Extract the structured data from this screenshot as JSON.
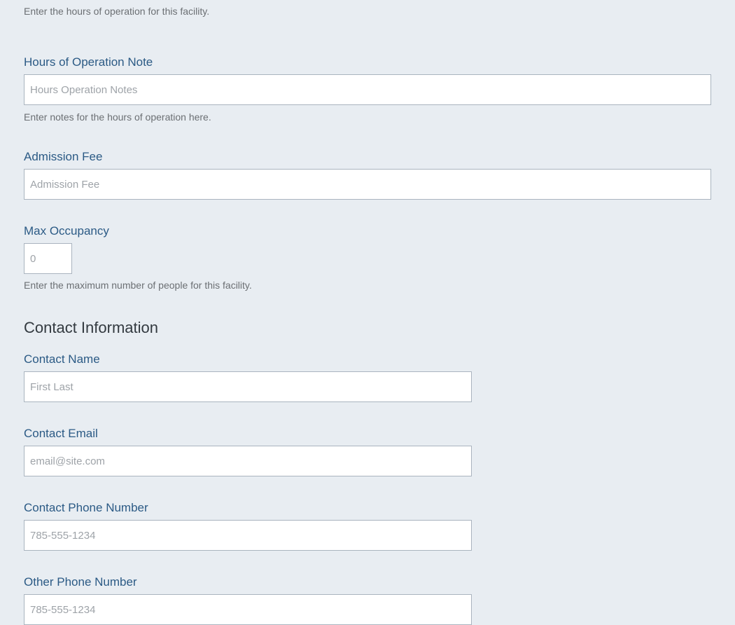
{
  "hours": {
    "help": "Enter the hours of operation for this facility."
  },
  "hours_note": {
    "label": "Hours of Operation Note",
    "placeholder": "Hours Operation Notes",
    "help": "Enter notes for the hours of operation here."
  },
  "admission_fee": {
    "label": "Admission Fee",
    "placeholder": "Admission Fee"
  },
  "max_occupancy": {
    "label": "Max Occupancy",
    "placeholder": "0",
    "help": "Enter the maximum number of people for this facility."
  },
  "contact_section": {
    "title": "Contact Information"
  },
  "contact_name": {
    "label": "Contact Name",
    "placeholder": "First Last"
  },
  "contact_email": {
    "label": "Contact Email",
    "placeholder": "email@site.com"
  },
  "contact_phone": {
    "label": "Contact Phone Number",
    "placeholder": "785-555-1234"
  },
  "other_phone": {
    "label": "Other Phone Number",
    "placeholder": "785-555-1234"
  }
}
